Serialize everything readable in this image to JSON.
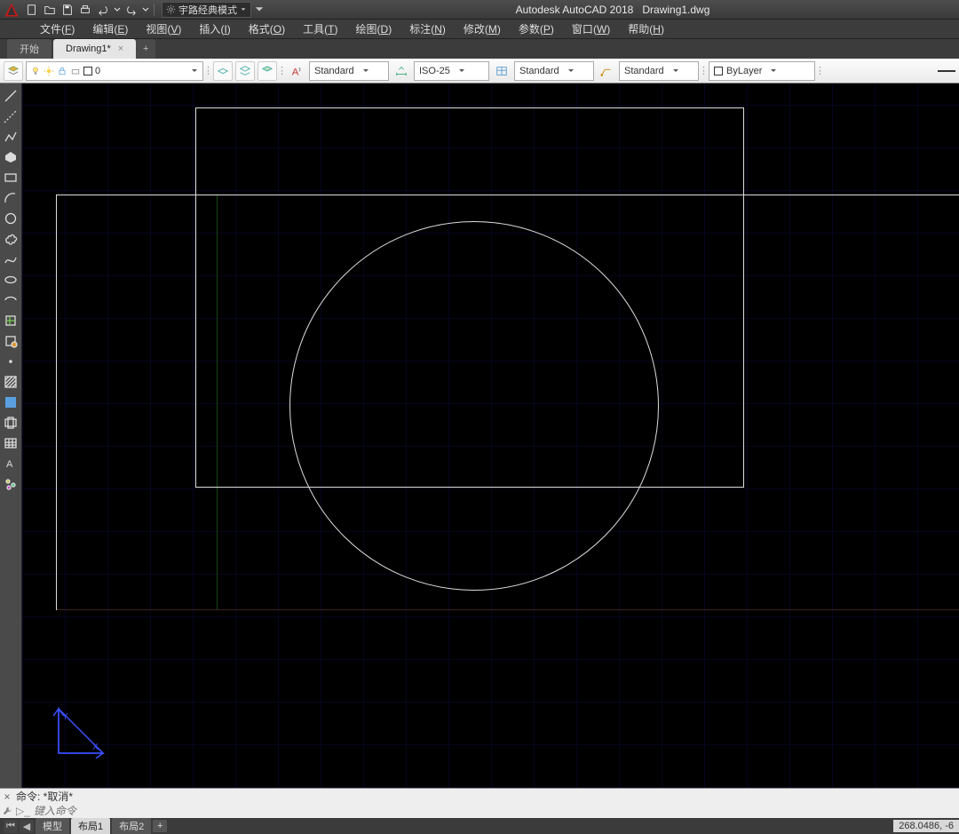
{
  "title": {
    "app": "Autodesk AutoCAD 2018",
    "file": "Drawing1.dwg"
  },
  "workspace_selector": "宇路经典模式",
  "menus": [
    {
      "label": "文件",
      "key": "F"
    },
    {
      "label": "编辑",
      "key": "E"
    },
    {
      "label": "视图",
      "key": "V"
    },
    {
      "label": "插入",
      "key": "I"
    },
    {
      "label": "格式",
      "key": "O"
    },
    {
      "label": "工具",
      "key": "T"
    },
    {
      "label": "绘图",
      "key": "D"
    },
    {
      "label": "标注",
      "key": "N"
    },
    {
      "label": "修改",
      "key": "M"
    },
    {
      "label": "参数",
      "key": "P"
    },
    {
      "label": "窗口",
      "key": "W"
    },
    {
      "label": "帮助",
      "key": "H"
    }
  ],
  "doctabs": {
    "start": "开始",
    "active": "Drawing1*"
  },
  "propbar": {
    "layer_name": "0",
    "text_style": "Standard",
    "dim_style": "ISO-25",
    "table_style": "Standard",
    "ml_style": "Standard",
    "color": "ByLayer"
  },
  "command": {
    "history": "命令: *取消*",
    "placeholder": "键入命令"
  },
  "bottom_tabs": {
    "model": "模型",
    "layout1": "布局1",
    "layout2": "布局2"
  },
  "status": {
    "coord": "268.0486, -6"
  },
  "ucs_labels": {
    "x": "X",
    "y": "Y"
  }
}
